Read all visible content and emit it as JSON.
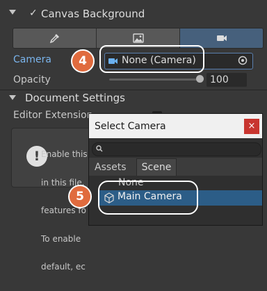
{
  "canvas_background": {
    "title": "Canvas Background",
    "checkbox_mark": "✓",
    "mode_buttons": [
      {
        "icon": "eyedropper-icon"
      },
      {
        "icon": "image-icon"
      },
      {
        "icon": "video-camera-icon",
        "selected": true
      }
    ],
    "camera": {
      "label": "Camera",
      "value": "None (Camera)"
    },
    "opacity": {
      "label": "Opacity",
      "value": "100",
      "level_percent": 100
    }
  },
  "document_settings": {
    "title": "Document Settings",
    "editor_extension_label": "Editor Extension",
    "help_text_lines": [
      "Enable this",
      "in this file.",
      "features fo",
      "To enable",
      "default, ec"
    ]
  },
  "select_camera_popup": {
    "title": "Select Camera",
    "close_glyph": "×",
    "search_placeholder": "",
    "tabs": [
      {
        "label": "Assets",
        "selected": false
      },
      {
        "label": "Scene",
        "selected": true
      }
    ],
    "items": [
      {
        "label": "None",
        "selected": false
      },
      {
        "label": "Main Camera",
        "selected": true
      }
    ]
  },
  "callouts": {
    "step_4": "4",
    "step_5": "5"
  },
  "colors": {
    "accent": "#46607c",
    "selection": "#2c5d87",
    "callout": "#e06b3e",
    "label_blue": "#7ab4ec"
  }
}
